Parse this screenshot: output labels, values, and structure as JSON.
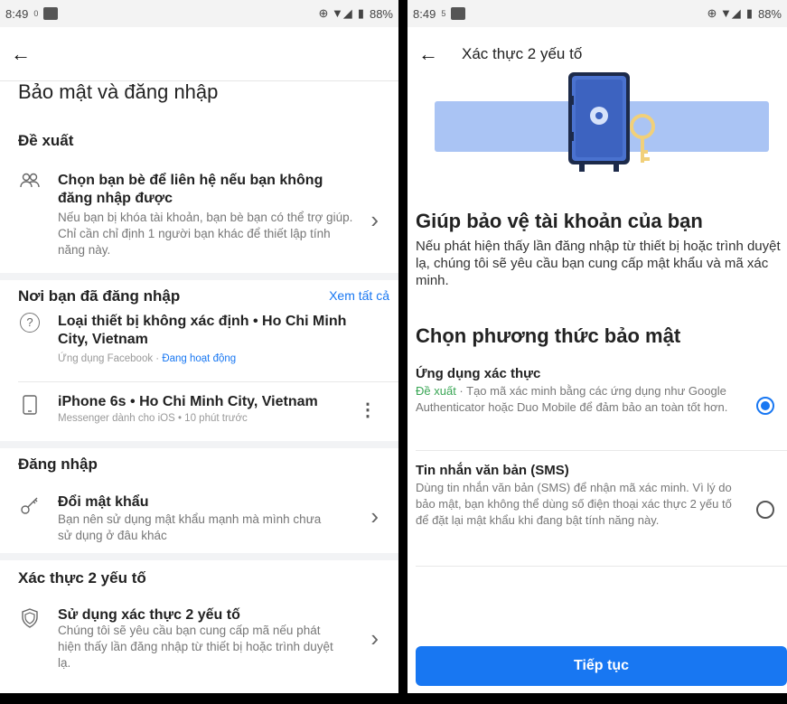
{
  "left": {
    "status": {
      "time": "8:49",
      "note": "0",
      "battery": "88%"
    },
    "page_title": "Bảo mật và đăng nhập",
    "suggest": {
      "header": "Đề xuất",
      "title": "Chọn bạn bè để liên hệ nếu bạn không đăng nhập được",
      "desc": "Nếu bạn bị khóa tài khoản, bạn bè bạn có thể trợ giúp. Chỉ cần chỉ định 1 người bạn khác để thiết lập tính năng này."
    },
    "logins": {
      "header": "Nơi bạn đã đăng nhập",
      "see_all": "Xem tất cả",
      "items": [
        {
          "title": "Loại thiết bị không xác định • Ho Chi Minh City, Vietnam",
          "sub": "Ứng dụng Facebook · ",
          "active": "Đang hoạt động"
        },
        {
          "title": "iPhone 6s • Ho Chi Minh City, Vietnam",
          "sub": "Messenger dành cho iOS • 10 phút trước"
        }
      ]
    },
    "login": {
      "header": "Đăng nhập",
      "title": "Đổi mật khẩu",
      "desc": "Bạn nên sử dụng mật khẩu mạnh mà mình chưa sử dụng ở đâu khác"
    },
    "twofa": {
      "header": "Xác thực 2 yếu tố",
      "title": "Sử dụng xác thực 2 yếu tố",
      "desc": "Chúng tôi sẽ yêu cầu bạn cung cấp mã nếu phát hiện thấy lần đăng nhập từ thiết bị hoặc trình duyệt lạ."
    }
  },
  "right": {
    "status": {
      "time": "8:49",
      "note": "5",
      "battery": "88%"
    },
    "appbar_title": "Xác thực 2 yếu tố",
    "heading": "Giúp bảo vệ tài khoản của bạn",
    "para": "Nếu phát hiện thấy lần đăng nhập từ thiết bị hoặc trình duyệt lạ, chúng tôi sẽ yêu cầu bạn cung cấp mật khẩu và mã xác minh.",
    "choose": "Chọn phương thức bảo mật",
    "options": [
      {
        "title": "Ứng dụng xác thực",
        "tag": "Đề xuất",
        "desc": " · Tạo mã xác minh bằng các ứng dụng như Google Authenticator hoặc Duo Mobile để đảm bảo an toàn tốt hơn.",
        "selected": true
      },
      {
        "title": "Tin nhắn văn bản (SMS)",
        "desc": "Dùng tin nhắn văn bản (SMS) để nhận mã xác minh. Vì lý do bảo mật, bạn không thể dùng số điện thoại xác thực 2 yếu tố để đặt lại mật khẩu khi đang bật tính năng này.",
        "selected": false
      }
    ],
    "cta": "Tiếp tục"
  }
}
